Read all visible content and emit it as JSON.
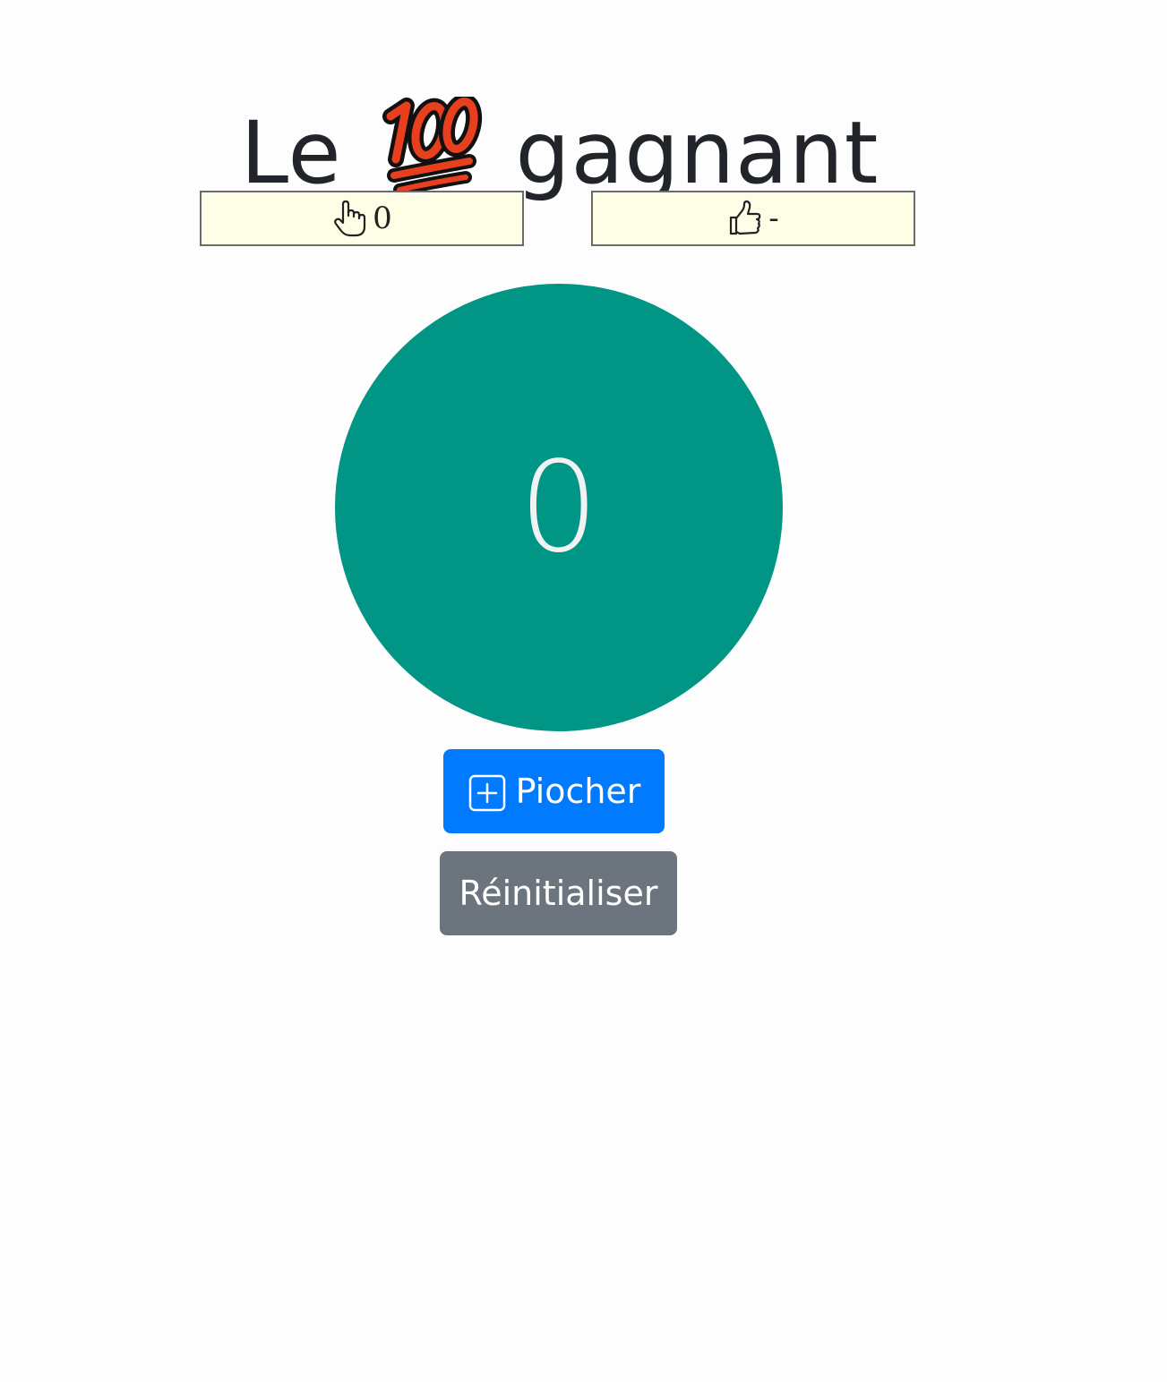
{
  "title": {
    "prefix": "Le",
    "emoji_icon": "hundred-points-emoji",
    "suffix": "gagnant"
  },
  "counters": {
    "draws": {
      "icon": "pointing-hand-icon",
      "value": "0"
    },
    "result": {
      "icon": "thumbs-up-icon",
      "value": "-"
    }
  },
  "ball": {
    "value": "0",
    "color": "#009585"
  },
  "buttons": {
    "draw": {
      "icon": "plus-square-icon",
      "label": "Piocher",
      "color": "#007bff"
    },
    "reset": {
      "label": "Réinitialiser",
      "color": "#6c757d"
    }
  }
}
